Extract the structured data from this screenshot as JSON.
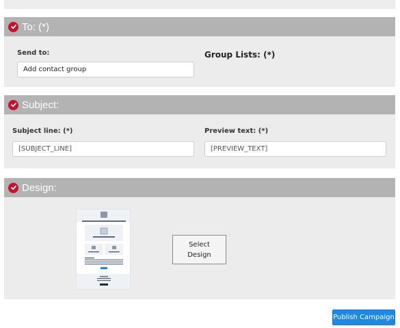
{
  "sections": {
    "to": {
      "title": "To: (*)",
      "send_to_label": "Send to:",
      "send_to_value": "Add contact group",
      "group_lists_label": "Group Lists: (*)"
    },
    "subject": {
      "title": "Subject:",
      "subject_line_label": "Subject line: (*)",
      "subject_line_value": "[SUBJECT_LINE]",
      "preview_text_label": "Preview text: (*)",
      "preview_text_value": "[PREVIEW_TEXT]"
    },
    "design": {
      "title": "Design:",
      "select_design_label": "Select Design"
    }
  },
  "actions": {
    "publish_label": "Publish Campaign"
  },
  "colors": {
    "section_bg": "#ececec",
    "header_bg": "#b3b3b3",
    "check_red": "#c8102e",
    "primary_blue": "#1e88e5"
  },
  "icons": {
    "section_check": "check-circle-icon",
    "template_preview": "template-thumbnail"
  }
}
